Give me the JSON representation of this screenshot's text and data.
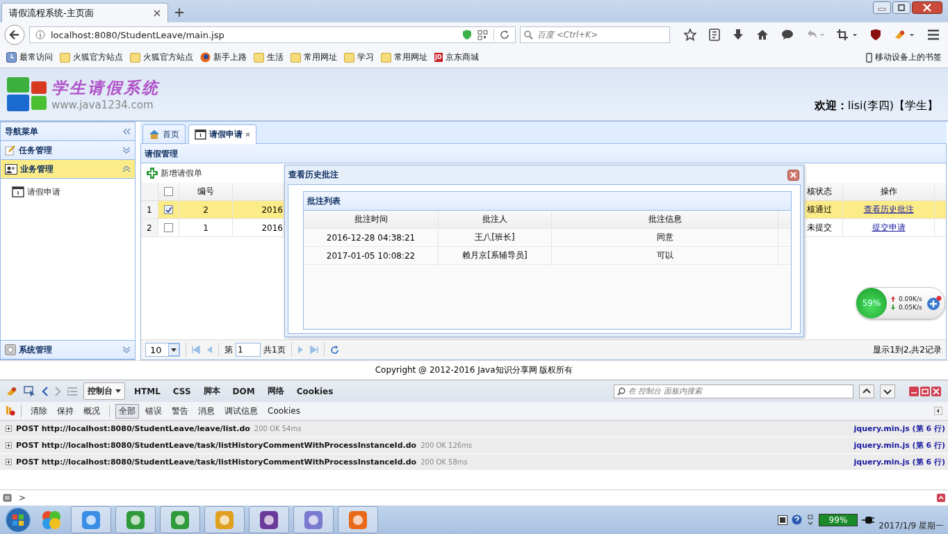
{
  "browser": {
    "tab_title": "请假流程系统-主页面",
    "url": "localhost:8080/StudentLeave/main.jsp",
    "search_placeholder": "百度 <Ctrl+K>",
    "bookmarks": [
      {
        "label": "最常访问",
        "kind": "recent"
      },
      {
        "label": "火狐官方站点",
        "kind": "folder"
      },
      {
        "label": "火狐官方站点",
        "kind": "folder"
      },
      {
        "label": "新手上路",
        "kind": "firefox"
      },
      {
        "label": "生活",
        "kind": "folder"
      },
      {
        "label": "常用网址",
        "kind": "folder"
      },
      {
        "label": "学习",
        "kind": "folder"
      },
      {
        "label": "常用网址",
        "kind": "folder"
      },
      {
        "label": "京东商城",
        "kind": "jd",
        "icon_text": "JD"
      }
    ],
    "mobile_bookmarks": "移动设备上的书签"
  },
  "app": {
    "title": "学生请假系统",
    "site": "www.java1234.com",
    "welcome": "**欢迎：**lisi(李四)【学生】"
  },
  "sidebar": {
    "title": "导航菜单",
    "sections": [
      {
        "label": "任务管理",
        "expanded": false
      },
      {
        "label": "业务管理",
        "expanded": true,
        "items": [
          {
            "label": "请假申请"
          }
        ]
      },
      {
        "label": "系统管理",
        "expanded": false
      }
    ]
  },
  "tabs": [
    {
      "label": "首页",
      "selected": false,
      "closable": false
    },
    {
      "label": "请假申请",
      "selected": true,
      "closable": true
    }
  ],
  "panel": {
    "title": "请假管理",
    "add_button": "新增请假单",
    "header_checked": false,
    "columns": {
      "id": "编号",
      "status": "核状态",
      "action": "操作"
    },
    "rows": [
      {
        "index": "1",
        "checked": true,
        "selected": true,
        "id": "2",
        "date": "2016",
        "status": "核通过",
        "action": "查看历史批注"
      },
      {
        "index": "2",
        "checked": false,
        "selected": false,
        "id": "1",
        "date": "2016",
        "status": "未提交",
        "action": "提交申请"
      }
    ],
    "pagination": {
      "page_size": "10",
      "before": "第",
      "page": "1",
      "after": "共1页",
      "summary": "显示1到2,共2记录"
    }
  },
  "dialog": {
    "title": "查看历史批注",
    "list_title": "批注列表",
    "columns": [
      "批注时间",
      "批注人",
      "批注信息"
    ],
    "rows": [
      [
        "2016-12-28 04:38:21",
        "王八[班长]",
        "同意"
      ],
      [
        "2017-01-05 10:08:22",
        "赖月京[系辅导员]",
        "可以"
      ]
    ]
  },
  "footer": "Copyright @ 2012-2016 Java知识分享网 版权所有",
  "net_widget": {
    "percent": "59%",
    "up": "0.09K/s",
    "down": "0.05K/s"
  },
  "devtools": {
    "tabs": [
      {
        "label": "控制台",
        "selected": true
      },
      {
        "label": "HTML",
        "selected": false
      },
      {
        "label": "CSS",
        "selected": false
      },
      {
        "label": "脚本",
        "selected": false
      },
      {
        "label": "DOM",
        "selected": false
      },
      {
        "label": "网络",
        "selected": false
      },
      {
        "label": "Cookies",
        "selected": false
      }
    ],
    "search_placeholder": "在 控制台 面板内搜索",
    "actions": [
      "清除",
      "保持",
      "概况"
    ],
    "filters": [
      {
        "label": "全部",
        "selected": true
      },
      {
        "label": "错误",
        "selected": false
      },
      {
        "label": "警告",
        "selected": false
      },
      {
        "label": "消息",
        "selected": false
      },
      {
        "label": "调试信息",
        "selected": false
      },
      {
        "label": "Cookies",
        "selected": false
      }
    ],
    "log": [
      {
        "request": "POST http://localhost:8080/StudentLeave/leave/list.do",
        "status": "200 OK 54ms",
        "source": "jquery.min.js (第 6 行)"
      },
      {
        "request": "POST http://localhost:8080/StudentLeave/task/listHistoryCommentWithProcessInstanceId.do",
        "status": "200 OK 126ms",
        "source": "jquery.min.js (第 6 行)"
      },
      {
        "request": "POST http://localhost:8080/StudentLeave/task/listHistoryCommentWithProcessInstanceId.do",
        "status": "200 OK 58ms",
        "source": "jquery.min.js (第 6 行)"
      }
    ],
    "prompt": ">"
  },
  "taskbar": {
    "battery": "99%",
    "date": "2017/1/9 星期一"
  }
}
